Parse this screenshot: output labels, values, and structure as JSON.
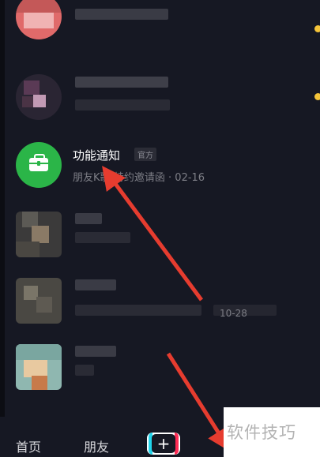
{
  "feed": {
    "function_notice": {
      "title": "功能通知",
      "badge": "官方",
      "subtitle": "朋友K歌/特约邀请函 · 02-16",
      "icon": "briefcase-icon"
    },
    "blurred_time": "10-28"
  },
  "tabbar": {
    "home": "首页",
    "friends": "朋友",
    "plus": "+"
  },
  "watermark": "软件技巧",
  "colors": {
    "background": "#161823",
    "notice_green": "#2bb548",
    "unread_dot": "#f5c43a",
    "arrow": "#e63c2f"
  }
}
